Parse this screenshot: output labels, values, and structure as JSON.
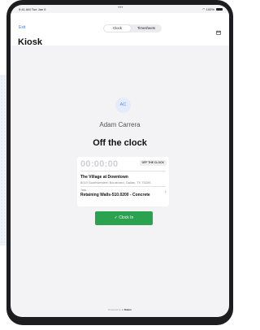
{
  "status_bar": {
    "time": "9:41 AM  Tue Jan 9",
    "dots": "•••",
    "right": "100%"
  },
  "navbar": {
    "exit_label": "Exit",
    "tabs": [
      {
        "label": "Clock",
        "selected": true
      },
      {
        "label": "Timesheets",
        "selected": false
      }
    ],
    "title": "Kiosk",
    "calendar_icon": "calendar-icon"
  },
  "user": {
    "initials": "AC",
    "name": "Adam Carrera",
    "status": "Off the clock"
  },
  "clock_card": {
    "timer": "00:00:00",
    "badge": "OFF THE CLOCK",
    "job_name": "The Village at Downtown",
    "job_address": "8010 Southwestern Boulevard, Dallas, TX 75206",
    "task_label": "Task",
    "task_value": "Retaining Walls-510.0200 - Concrete"
  },
  "actions": {
    "clock_in_label": "✓  Clock In"
  },
  "footer": {
    "powered_by": "Powered by",
    "brand": "Raken"
  },
  "colors": {
    "accent": "#2f7bf6",
    "clock_in_green": "#2aa24f",
    "screen_bg": "#f3f3f6"
  }
}
